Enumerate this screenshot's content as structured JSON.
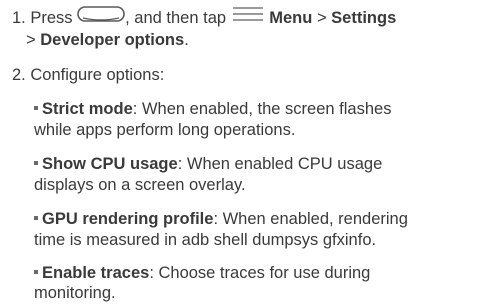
{
  "steps": [
    {
      "number": "1.",
      "text_press": "Press",
      "text_then_tap": ", and then tap",
      "menu": "Menu",
      "gt1": ">",
      "settings": "Settings",
      "gt2": ">",
      "developer_options": "Developer options",
      "period": ".",
      "icons": [
        "home-key-icon",
        "menu-key-icon"
      ]
    },
    {
      "number": "2.",
      "text": "Configure options:"
    }
  ],
  "options": [
    {
      "name": "Strict mode",
      "line1": ": When enabled, the screen flashes",
      "line2": "while apps perform long operations."
    },
    {
      "name": "Show CPU usage",
      "line1": ": When enabled CPU usage",
      "line2": "displays on a screen overlay."
    },
    {
      "name": "GPU rendering profile",
      "line1": ": When enabled, rendering",
      "line2": "time is measured in adb shell dumpsys gfxinfo."
    },
    {
      "name": "Enable traces",
      "line1": ": Choose traces for use during",
      "line2": "monitoring."
    }
  ]
}
